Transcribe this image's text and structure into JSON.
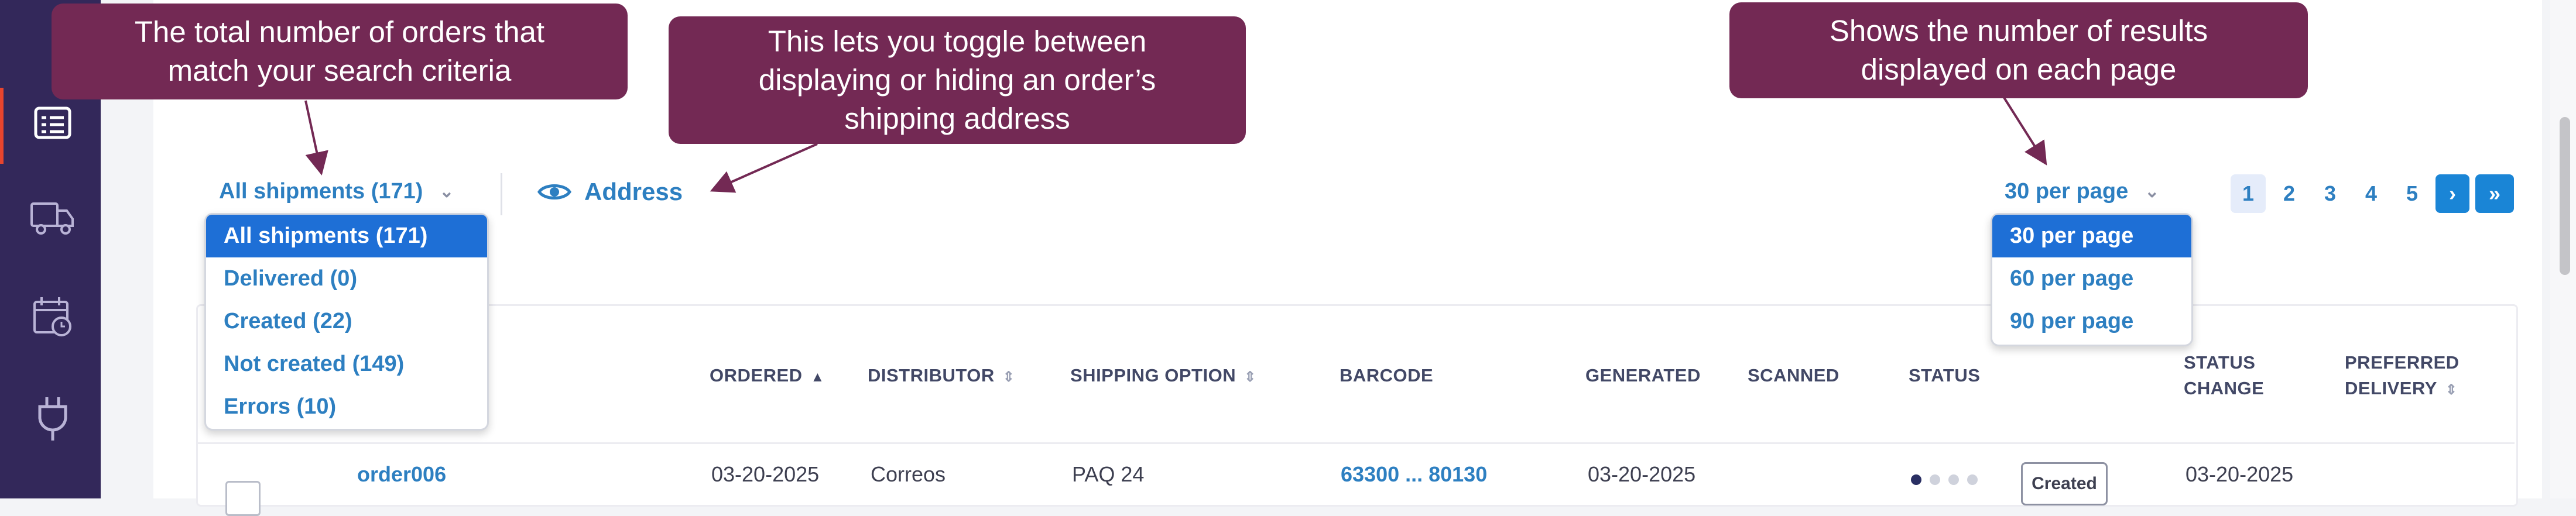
{
  "sidebar": {
    "items": [
      {
        "icon": "orders-icon",
        "active": true
      },
      {
        "icon": "truck-icon"
      },
      {
        "icon": "calendar-clock-icon"
      },
      {
        "icon": "plug-icon"
      }
    ]
  },
  "filter": {
    "label": "All shipments (171)",
    "options": [
      {
        "label": "All shipments (171)",
        "selected": true
      },
      {
        "label": "Delivered (0)"
      },
      {
        "label": "Created (22)"
      },
      {
        "label": "Not created (149)"
      },
      {
        "label": "Errors (10)"
      }
    ]
  },
  "address_toggle": {
    "label": "Address",
    "icon": "eye-icon"
  },
  "per_page": {
    "label": "30 per page",
    "options": [
      {
        "label": "30 per page",
        "selected": true
      },
      {
        "label": "60 per page"
      },
      {
        "label": "90 per page"
      }
    ]
  },
  "pagination": {
    "pages": [
      "1",
      "2",
      "3",
      "4",
      "5"
    ],
    "current": "1",
    "next": "›",
    "last": "»"
  },
  "table": {
    "headers": {
      "ordered": "ORDERED",
      "distributor": "DISTRIBUTOR",
      "shipping_option": "SHIPPING OPTION",
      "barcode": "BARCODE",
      "generated": "GENERATED",
      "scanned": "SCANNED",
      "status": "STATUS",
      "status_change_1": "STATUS",
      "status_change_2": "CHANGE",
      "preferred_1": "PREFERRED",
      "preferred_2": "DELIVERY"
    },
    "rows": [
      {
        "order": "order006",
        "ordered": "03-20-2025",
        "distributor": "Correos",
        "shipping_option": "PAQ 24",
        "barcode": "63300 ... 80130",
        "generated": "03-20-2025",
        "scanned": "",
        "status_steps": 4,
        "status_step_active": 1,
        "status_badge": "Created",
        "status_change": "03-20-2025",
        "preferred_delivery": ""
      }
    ]
  },
  "callouts": {
    "total_orders": {
      "line1": "The total number of orders that",
      "line2": "match your search criteria"
    },
    "address_toggle": {
      "line1": "This lets you toggle between",
      "line2": "displaying or hiding an order’s",
      "line3": "shipping address"
    },
    "per_page": {
      "line1": "Shows the number of results",
      "line2": "displayed on each page"
    }
  },
  "colors": {
    "sidebar": "#33285a",
    "accent": "#2d7fc1",
    "selected_option": "#1e6fd6",
    "callout": "#732954",
    "active_marker": "#e8452e"
  }
}
